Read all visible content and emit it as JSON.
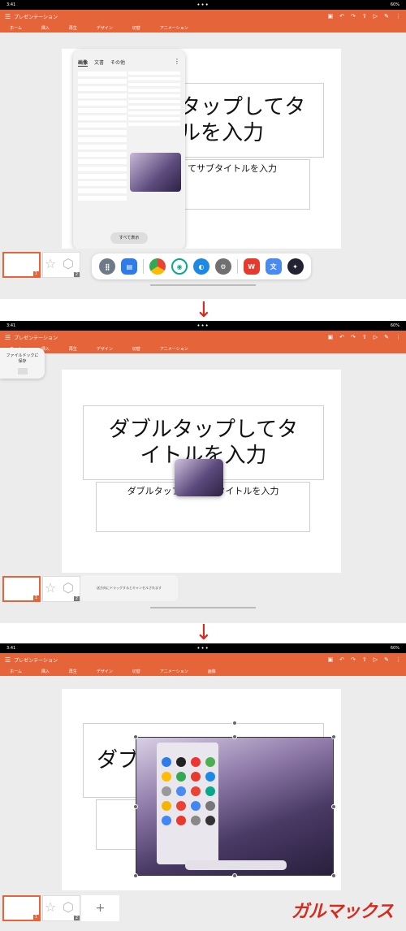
{
  "status": {
    "time": "3:41",
    "battery": "60%"
  },
  "app": {
    "title": "プレゼンテーション"
  },
  "ribbon_tabs": [
    "ホーム",
    "挿入",
    "再生",
    "デザイン",
    "切替",
    "アニメーション"
  ],
  "ribbon_tabs_p3": [
    "ホーム",
    "挿入",
    "再生",
    "デザイン",
    "切替",
    "アニメーション",
    "画像"
  ],
  "slide": {
    "title_line1": "ダブルタップしてタ",
    "title_line2": "イトルを入力",
    "title_partial_1a": "タップしてタ",
    "title_partial_1b": "ルを入力",
    "subtitle": "ダブルタップしてサブタイトルを入力",
    "subtitle_partial": "てサブタイトルを入力",
    "subtitle_partial_3": "ダブ"
  },
  "popup": {
    "tabs": [
      "画像",
      "文書",
      "その他"
    ],
    "show_all": "すべて表示"
  },
  "save_pill": {
    "line1": "ファイルドックに",
    "line2": "保存"
  },
  "cancel_hint": "送方向にドラッグするとキャンセルされます",
  "thumb_numbers": [
    "1",
    "2"
  ],
  "add_slide": "+",
  "watermark": "ガルマックス",
  "colors": {
    "accent": "#e6643a",
    "arrow": "#d72a1d"
  }
}
